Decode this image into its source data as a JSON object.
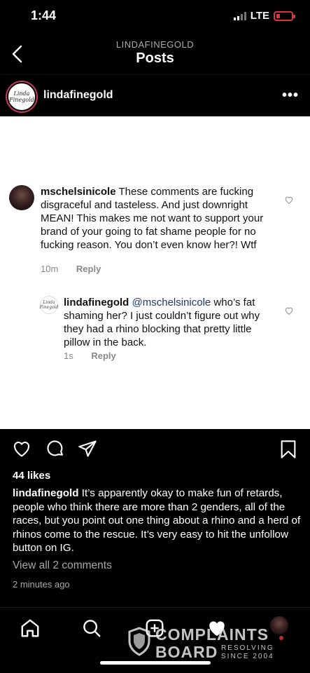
{
  "status_bar": {
    "time": "1:44",
    "network": "LTE"
  },
  "header": {
    "subtitle": "LINDAFINEGOLD",
    "title": "Posts"
  },
  "post": {
    "username": "lindafinegold",
    "avatar_text": "Linda Finegold",
    "image_comments": [
      {
        "username": "mschelsinicole",
        "text": "These comments are fucking disgraceful and tasteless. And just downright MEAN! This makes me not want to support your brand of your going to fat shame people for no fucking reason. You don’t even know her?! Wtf",
        "time": "10m",
        "reply_label": "Reply"
      },
      {
        "username": "lindafinegold",
        "mention": "@mschelsinicole",
        "text": " who’s fat shaming her? I just couldn’t figure out why they had a rhino blocking that pretty little pillow in the back.",
        "time": "1s",
        "reply_label": "Reply"
      }
    ],
    "likes": "44 likes",
    "caption_user": "lindafinegold",
    "caption_text": " It’s apparently okay to make fun of retards, people who think there are more than 2 genders, all of the races, but you point out one thing about a rhino and a herd of rhinos come to the rescue. It’s very easy to hit the unfollow button on IG.",
    "view_all": "View all 2 comments",
    "posted_ago": "2 minutes ago"
  },
  "watermark": {
    "line1": "COMPLAINTS",
    "line2": "BOARD",
    "right1": "RESOLVING",
    "right2": "SINCE 2004"
  },
  "icons": [
    "back-icon",
    "more-icon",
    "heart-icon",
    "comment-icon",
    "share-icon",
    "bookmark-icon",
    "home-icon",
    "search-icon",
    "add-icon",
    "activity-icon"
  ],
  "colors": {
    "background": "#000000",
    "mention": "#1e3a6e",
    "muted": "#a8a8a8",
    "battery": "#e0313a"
  }
}
